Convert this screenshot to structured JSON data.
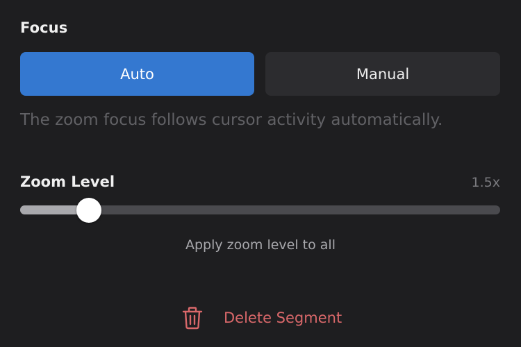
{
  "focus": {
    "title": "Focus",
    "options": [
      {
        "label": "Auto",
        "selected": true
      },
      {
        "label": "Manual",
        "selected": false
      }
    ],
    "description": "The zoom focus follows cursor activity automatically."
  },
  "zoom": {
    "label": "Zoom Level",
    "value_text": "1.5x",
    "slider_fraction": 0.143,
    "apply_label": "Apply zoom level to all"
  },
  "delete": {
    "label": "Delete Segment",
    "icon": "trash-icon",
    "color": "#d9686a"
  },
  "colors": {
    "background": "#1e1e20",
    "accent": "#3478d0",
    "secondary_button": "#2c2c2f",
    "danger": "#d9686a"
  }
}
